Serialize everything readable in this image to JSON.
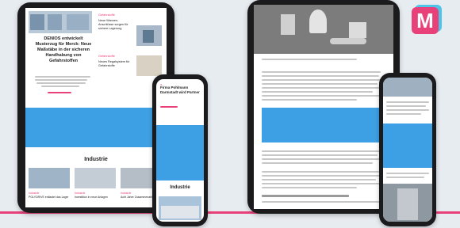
{
  "brand": {
    "logo_letter": "M",
    "colors": {
      "accent": "#e8417a",
      "ad_blue": "#3ea0e4",
      "logo_blue": "#4fc3e8"
    }
  },
  "tablet_left": {
    "lead_title": "DENIOS entwickelt Musterzug für Merck: Neue Maßstäbe in der sicheren Handhabung von Gefahrstoffen",
    "side_label_1": "Gefahrstoffe",
    "side_title_1": "Neue Wannen-Anschlüsse sorgen für sichere Lagerung",
    "side_label_2": "Gefahrstoffe",
    "side_title_2": "Neues Regalsystem für Gefahrstoffe",
    "section_title": "Industrie",
    "card_label_1": "Industrie",
    "card_label_2": "Industrie",
    "card_label_3": "Industrie",
    "card_title_1": "POLYDRIVE entlastet das Lager",
    "card_title_2": "Investition in neue Anlagen",
    "card_title_3": "Acht Jahre Zusammenarbeit"
  },
  "phone_left": {
    "title": "Firma Pohlmann Darmstadt wird Partner",
    "section_title": "Industrie"
  }
}
